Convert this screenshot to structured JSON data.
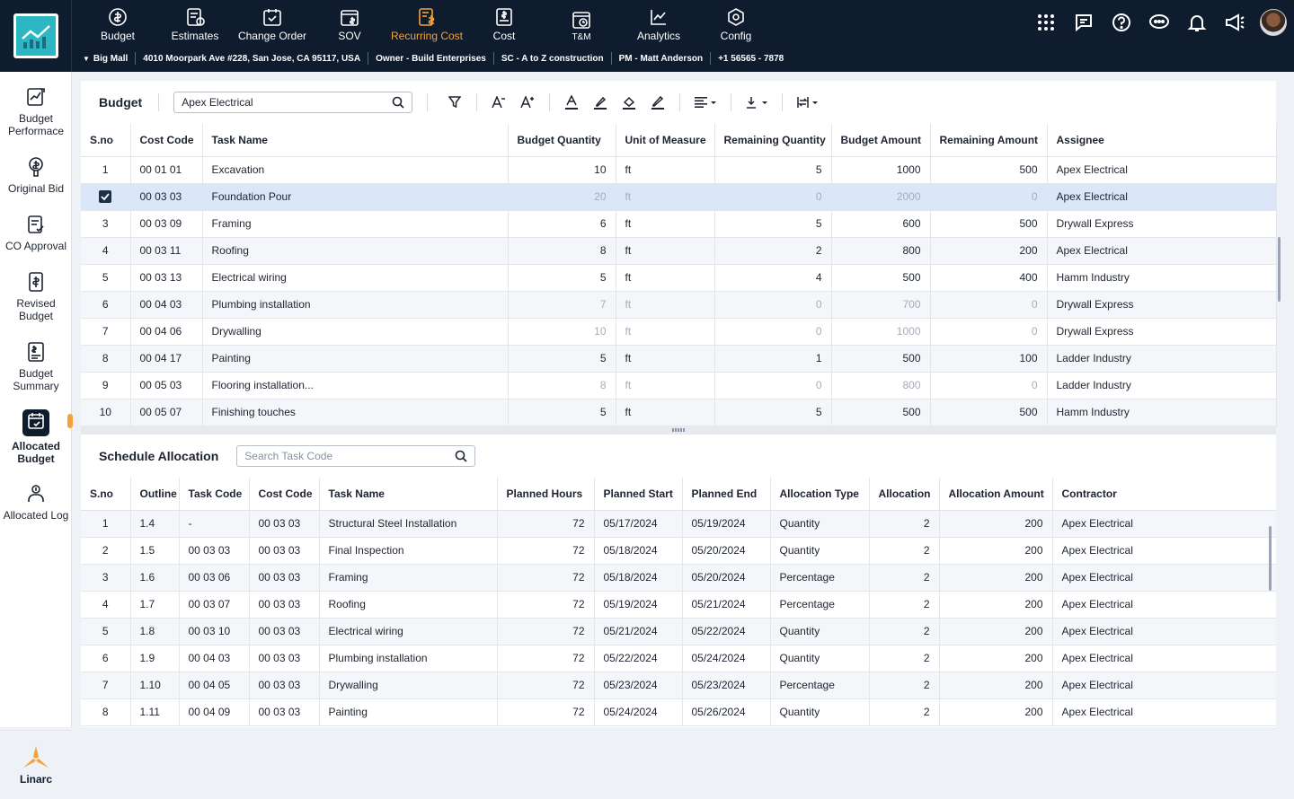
{
  "nav": {
    "items": [
      {
        "label": "Budget",
        "icon": "budget-icon"
      },
      {
        "label": "Estimates",
        "icon": "estimates-icon"
      },
      {
        "label": "Change Order",
        "icon": "change-order-icon"
      },
      {
        "label": "SOV",
        "icon": "sov-icon"
      },
      {
        "label": "Recurring Cost",
        "icon": "recurring-cost-icon",
        "active": true
      },
      {
        "label": "Cost",
        "icon": "cost-icon"
      },
      {
        "label": "T&M",
        "icon": "tm-icon"
      },
      {
        "label": "Analytics",
        "icon": "analytics-icon"
      },
      {
        "label": "Config",
        "icon": "config-icon"
      }
    ],
    "active_color": "#f4a33a"
  },
  "info": {
    "project": "Big Mall",
    "address": "4010 Moorpark Ave #228, San Jose, CA 95117, USA",
    "owner": "Owner - Build Enterprises",
    "sc": "SC - A to Z construction",
    "pm": "PM - Matt Anderson",
    "phone": "+1 56565 - 7878"
  },
  "sidebar": {
    "items": [
      {
        "label": "Budget Performace",
        "icon": "budget-performance-icon"
      },
      {
        "label": "Original Bid",
        "icon": "original-bid-icon"
      },
      {
        "label": "CO Approval",
        "icon": "co-approval-icon"
      },
      {
        "label": "Revised Budget",
        "icon": "revised-budget-icon"
      },
      {
        "label": "Budget Summary",
        "icon": "budget-summary-icon"
      },
      {
        "label": "Allocated Budget",
        "icon": "allocated-budget-icon",
        "active": true
      },
      {
        "label": "Allocated Log",
        "icon": "allocated-log-icon"
      }
    ],
    "brand": "Linarc"
  },
  "budget": {
    "title": "Budget",
    "search_value": "Apex Electrical",
    "columns": [
      "S.no",
      "Cost Code",
      "Task Name",
      "Budget Quantity",
      "Unit of Measure",
      "Remaining Quantity",
      "Budget Amount",
      "Remaining  Amount",
      "Assignee"
    ],
    "rows": [
      {
        "sno": "1",
        "code": "00 01 01",
        "task": "Excavation",
        "bq": "10",
        "uom": "ft",
        "rq": "5",
        "ba": "1000",
        "ra": "500",
        "assignee": "Apex Electrical"
      },
      {
        "sno": "",
        "checked": true,
        "selected": true,
        "dim": true,
        "code": "00 03 03",
        "task": "Foundation Pour",
        "bq": "20",
        "uom": "ft",
        "rq": "0",
        "ba": "2000",
        "ra": "0",
        "assignee": "Apex Electrical"
      },
      {
        "sno": "3",
        "code": "00 03 09",
        "task": "Framing",
        "bq": "6",
        "uom": "ft",
        "rq": "5",
        "ba": "600",
        "ra": "500",
        "assignee": "Drywall Express"
      },
      {
        "sno": "4",
        "code": "00 03 11",
        "task": "Roofing",
        "bq": "8",
        "uom": "ft",
        "rq": "2",
        "ba": "800",
        "ra": "200",
        "assignee": "Apex Electrical"
      },
      {
        "sno": "5",
        "code": "00 03 13",
        "task": "Electrical wiring",
        "bq": "5",
        "uom": "ft",
        "rq": "4",
        "ba": "500",
        "ra": "400",
        "assignee": "Hamm Industry"
      },
      {
        "sno": "6",
        "dim": true,
        "code": "00 04 03",
        "task": "Plumbing installation",
        "bq": "7",
        "uom": "ft",
        "rq": "0",
        "ba": "700",
        "ra": "0",
        "assignee": "Drywall Express"
      },
      {
        "sno": "7",
        "dim": true,
        "code": "00 04 06",
        "task": "Drywalling",
        "bq": "10",
        "uom": "ft",
        "rq": "0",
        "ba": "1000",
        "ra": "0",
        "assignee": "Drywall Express"
      },
      {
        "sno": "8",
        "code": "00 04 17",
        "task": "Painting",
        "bq": "5",
        "uom": "ft",
        "rq": "1",
        "ba": "500",
        "ra": "100",
        "assignee": "Ladder Industry"
      },
      {
        "sno": "9",
        "dim": true,
        "code": "00 05 03",
        "task": "Flooring installation...",
        "bq": "8",
        "uom": "ft",
        "rq": "0",
        "ba": "800",
        "ra": "0",
        "assignee": "Ladder Industry"
      },
      {
        "sno": "10",
        "code": "00 05 07",
        "task": "Finishing touches",
        "bq": "5",
        "uom": "ft",
        "rq": "5",
        "ba": "500",
        "ra": "500",
        "assignee": "Hamm Industry"
      }
    ]
  },
  "schedule": {
    "title": "Schedule Allocation",
    "search_placeholder": "Search Task Code",
    "columns": [
      "S.no",
      "Outline",
      "Task Code",
      "Cost Code",
      "Task Name",
      "Planned Hours",
      "Planned Start",
      "Planned End",
      "Allocation Type",
      "Allocation",
      "Allocation Amount",
      "Contractor"
    ],
    "rows": [
      {
        "sno": "1",
        "outline": "1.4",
        "tcode": "-",
        "ccode": "00 03 03",
        "task": "Structural Steel Installation",
        "hours": "72",
        "start": "05/17/2024",
        "end": "05/19/2024",
        "type": "Quantity",
        "alloc": "2",
        "amount": "200",
        "contractor": "Apex Electrical"
      },
      {
        "sno": "2",
        "outline": "1.5",
        "tcode": "00 03 03",
        "ccode": "00 03 03",
        "task": "Final Inspection",
        "hours": "72",
        "start": "05/18/2024",
        "end": "05/20/2024",
        "type": "Quantity",
        "alloc": "2",
        "amount": "200",
        "contractor": "Apex Electrical"
      },
      {
        "sno": "3",
        "outline": "1.6",
        "tcode": "00 03 06",
        "ccode": "00 03 03",
        "task": "Framing",
        "hours": "72",
        "start": "05/18/2024",
        "end": "05/20/2024",
        "type": "Percentage",
        "alloc": "2",
        "amount": "200",
        "contractor": "Apex Electrical"
      },
      {
        "sno": "4",
        "outline": "1.7",
        "tcode": "00 03 07",
        "ccode": "00 03 03",
        "task": "Roofing",
        "hours": "72",
        "start": "05/19/2024",
        "end": "05/21/2024",
        "type": "Percentage",
        "alloc": "2",
        "amount": "200",
        "contractor": "Apex Electrical"
      },
      {
        "sno": "5",
        "outline": "1.8",
        "tcode": "00 03 10",
        "ccode": "00 03 03",
        "task": "Electrical wiring",
        "hours": "72",
        "start": "05/21/2024",
        "end": "05/22/2024",
        "type": "Quantity",
        "alloc": "2",
        "amount": "200",
        "contractor": "Apex Electrical"
      },
      {
        "sno": "6",
        "outline": "1.9",
        "tcode": "00 04 03",
        "ccode": "00 03 03",
        "task": "Plumbing installation",
        "hours": "72",
        "start": "05/22/2024",
        "end": "05/24/2024",
        "type": "Quantity",
        "alloc": "2",
        "amount": "200",
        "contractor": "Apex Electrical"
      },
      {
        "sno": "7",
        "outline": "1.10",
        "tcode": "00 04 05",
        "ccode": "00 03 03",
        "task": "Drywalling",
        "hours": "72",
        "start": "05/23/2024",
        "end": "05/23/2024",
        "type": "Percentage",
        "alloc": "2",
        "amount": "200",
        "contractor": "Apex Electrical"
      },
      {
        "sno": "8",
        "outline": "1.11",
        "tcode": "00 04 09",
        "ccode": "00 03 03",
        "task": "Painting",
        "hours": "72",
        "start": "05/24/2024",
        "end": "05/26/2024",
        "type": "Quantity",
        "alloc": "2",
        "amount": "200",
        "contractor": "Apex Electrical"
      }
    ]
  }
}
